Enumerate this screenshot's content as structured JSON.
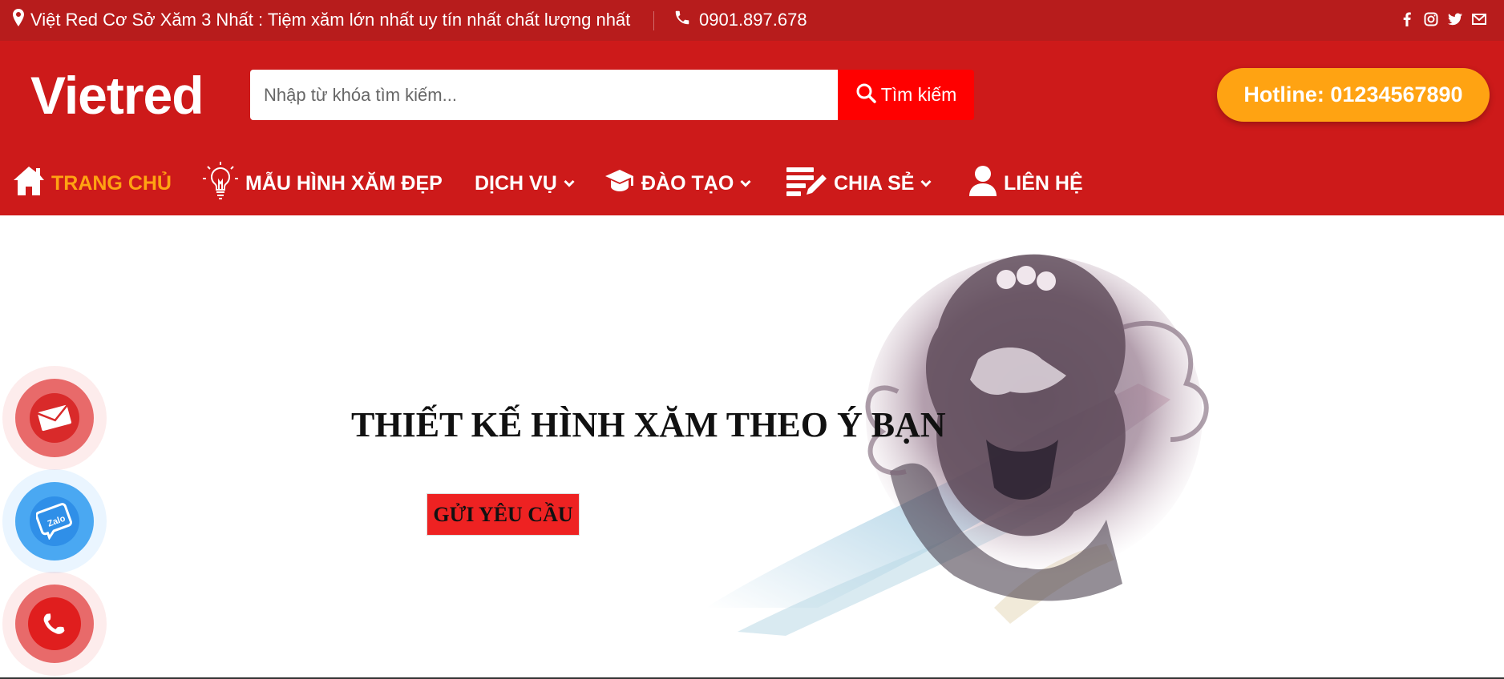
{
  "topbar": {
    "location_text": "Việt Red Cơ Sở Xăm 3 Nhất : Tiệm xăm lớn nhất uy tín nhất chất lượng nhất",
    "phone": "0901.897.678",
    "social_icons": [
      "facebook-icon",
      "instagram-icon",
      "twitter-icon",
      "email-icon"
    ]
  },
  "header": {
    "logo": "Vietred",
    "search_placeholder": "Nhập từ khóa tìm kiếm...",
    "search_button": "Tìm kiếm",
    "hotline": "Hotline: 01234567890"
  },
  "nav": [
    {
      "label": "TRANG CHỦ",
      "icon": "home-icon",
      "active": true
    },
    {
      "label": "MẪU HÌNH XĂM ĐẸP",
      "icon": "lightbulb-icon"
    },
    {
      "label": "DỊCH VỤ",
      "dropdown": true
    },
    {
      "label": "ĐÀO TẠO",
      "icon": "graduation-cap-icon",
      "dropdown": true
    },
    {
      "label": "CHIA SẺ",
      "icon": "edit-list-icon",
      "dropdown": true
    },
    {
      "label": "LIÊN HỆ",
      "icon": "user-icon"
    }
  ],
  "hero": {
    "title": "THIẾT KẾ HÌNH XĂM THEO Ý BẠN",
    "button": "GỬI YÊU CẦU"
  },
  "floating_buttons": [
    "email-icon",
    "zalo-icon",
    "phone-icon"
  ],
  "zalo_label": "Zalo",
  "colors": {
    "topbar": "#b71c1c",
    "header": "#cd1a1a",
    "accent": "#ffa312",
    "search_button": "#ff0000"
  }
}
